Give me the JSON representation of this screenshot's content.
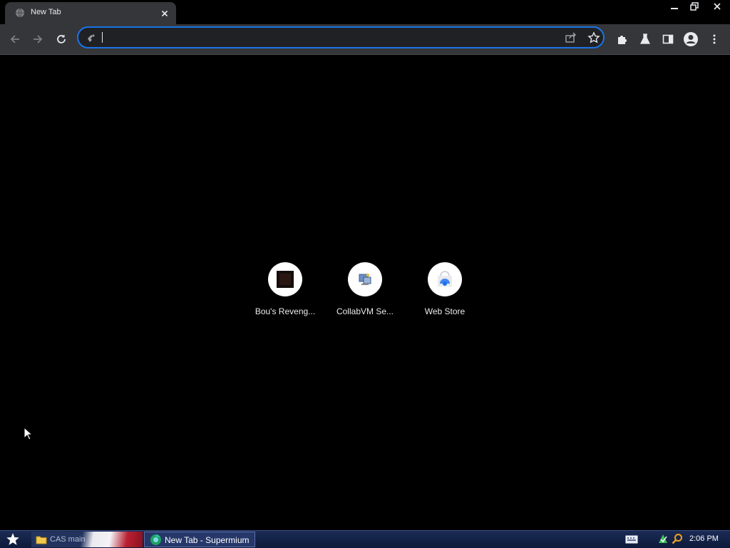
{
  "tab": {
    "title": "New Tab"
  },
  "omnibox": {
    "value": "",
    "placeholder": ""
  },
  "shortcuts": [
    {
      "label": "Bou's Reveng...",
      "icon": "dark-square-icon"
    },
    {
      "label": "CollabVM Se...",
      "icon": "computer-icon"
    },
    {
      "label": "Web Store",
      "icon": "web-store-icon"
    }
  ],
  "taskbar": {
    "folder_label": "CAS main",
    "browser_label": "New Tab - Supermium",
    "clock": "2:06 PM"
  },
  "colors": {
    "omnibox_border": "#1a73e8",
    "toolbar_bg": "#35363a",
    "page_bg": "#000000"
  }
}
